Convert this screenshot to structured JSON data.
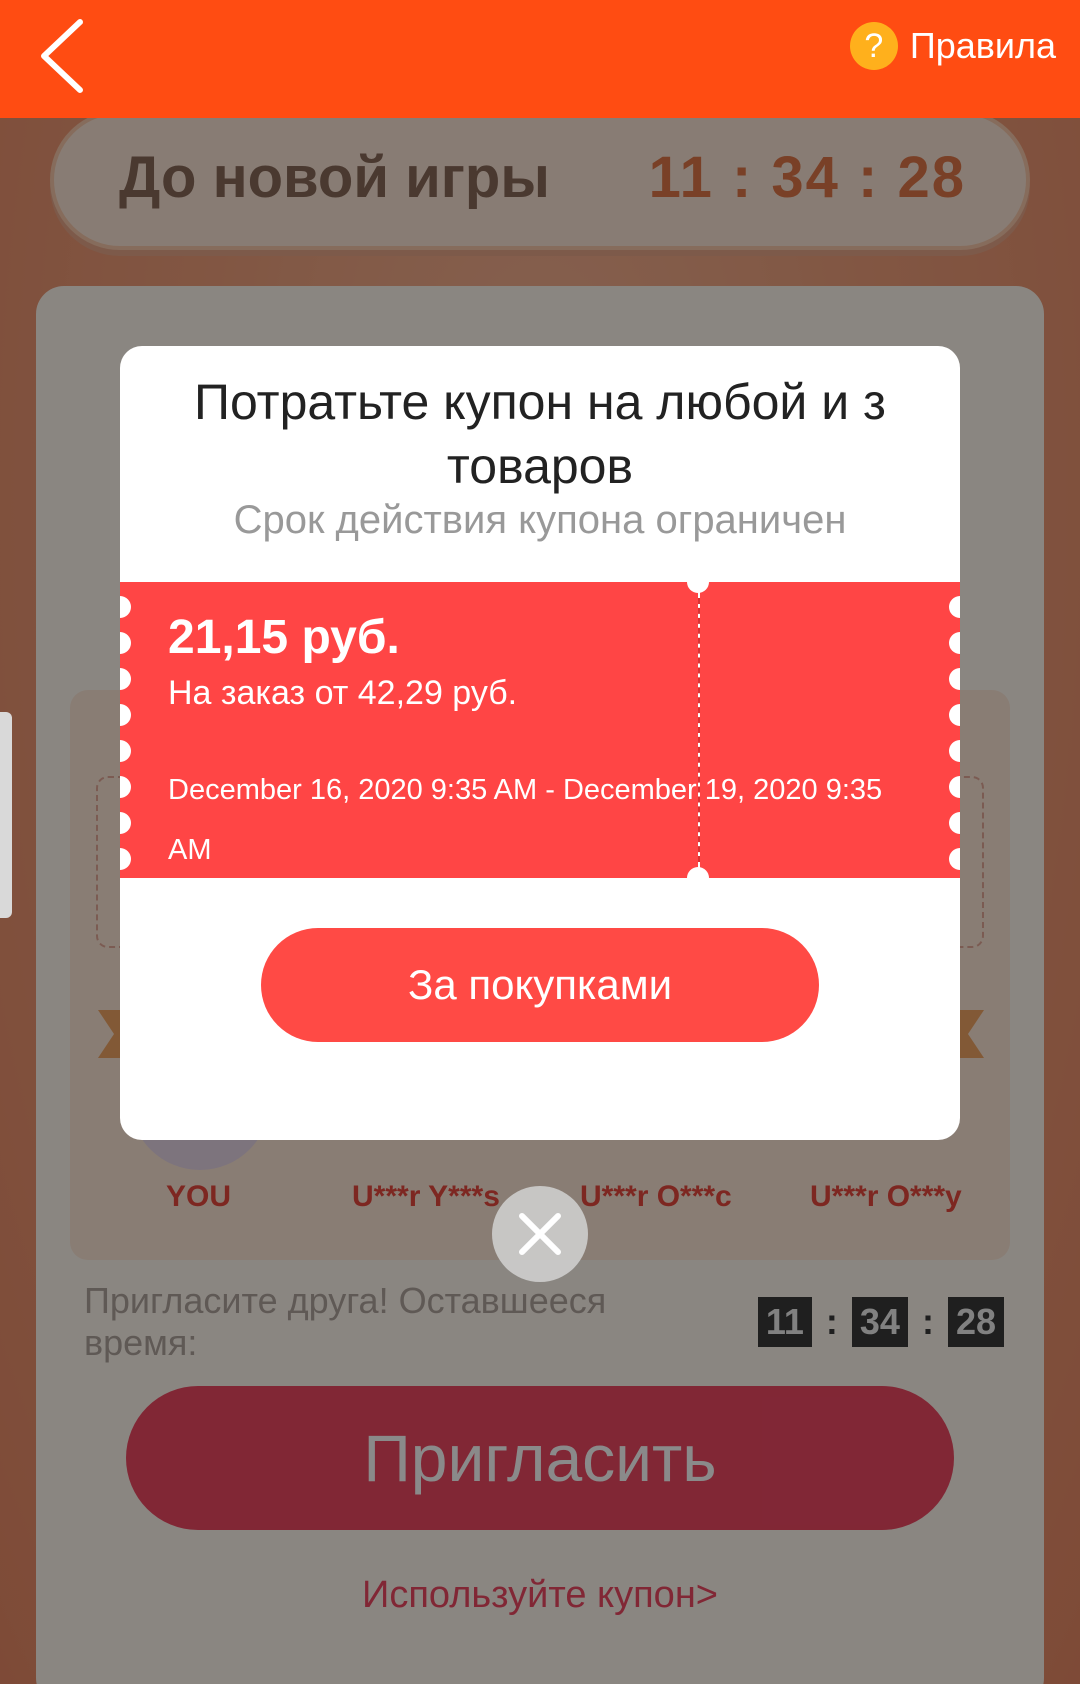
{
  "header": {
    "back_icon": "chevron-left-icon",
    "rules_icon": "question-icon",
    "rules_icon_glyph": "?",
    "rules_label": "Правила"
  },
  "next_game": {
    "label": "До новой игры",
    "time": "11 : 34 : 28"
  },
  "participants": [
    "YOU",
    "U***r Y***s",
    "U***r O***c",
    "U***r O***y"
  ],
  "invite": {
    "text": "Пригласите друга! Оставшееся время:",
    "hours": "11",
    "minutes": "34",
    "seconds": "28",
    "separator": ":",
    "button_label": "Пригласить",
    "coupon_link": "Используйте купон>"
  },
  "modal": {
    "title": "Потратьте купон на любой и з товаров",
    "subtitle": "Срок действия купона ограничен",
    "coupon": {
      "amount": "21,15 руб.",
      "min_order": "На заказ от 42,29 руб.",
      "validity": "December 16, 2020 9:35 AM - December 19, 2020 9:35 AM"
    },
    "shop_button": "За покупками",
    "close_icon": "close-icon"
  },
  "colors": {
    "header": "#ff4c12",
    "coupon": "#ff4545",
    "shop_button": "#ff4a45",
    "invite_button": "#ef4863",
    "help_icon": "#ffb01c"
  }
}
